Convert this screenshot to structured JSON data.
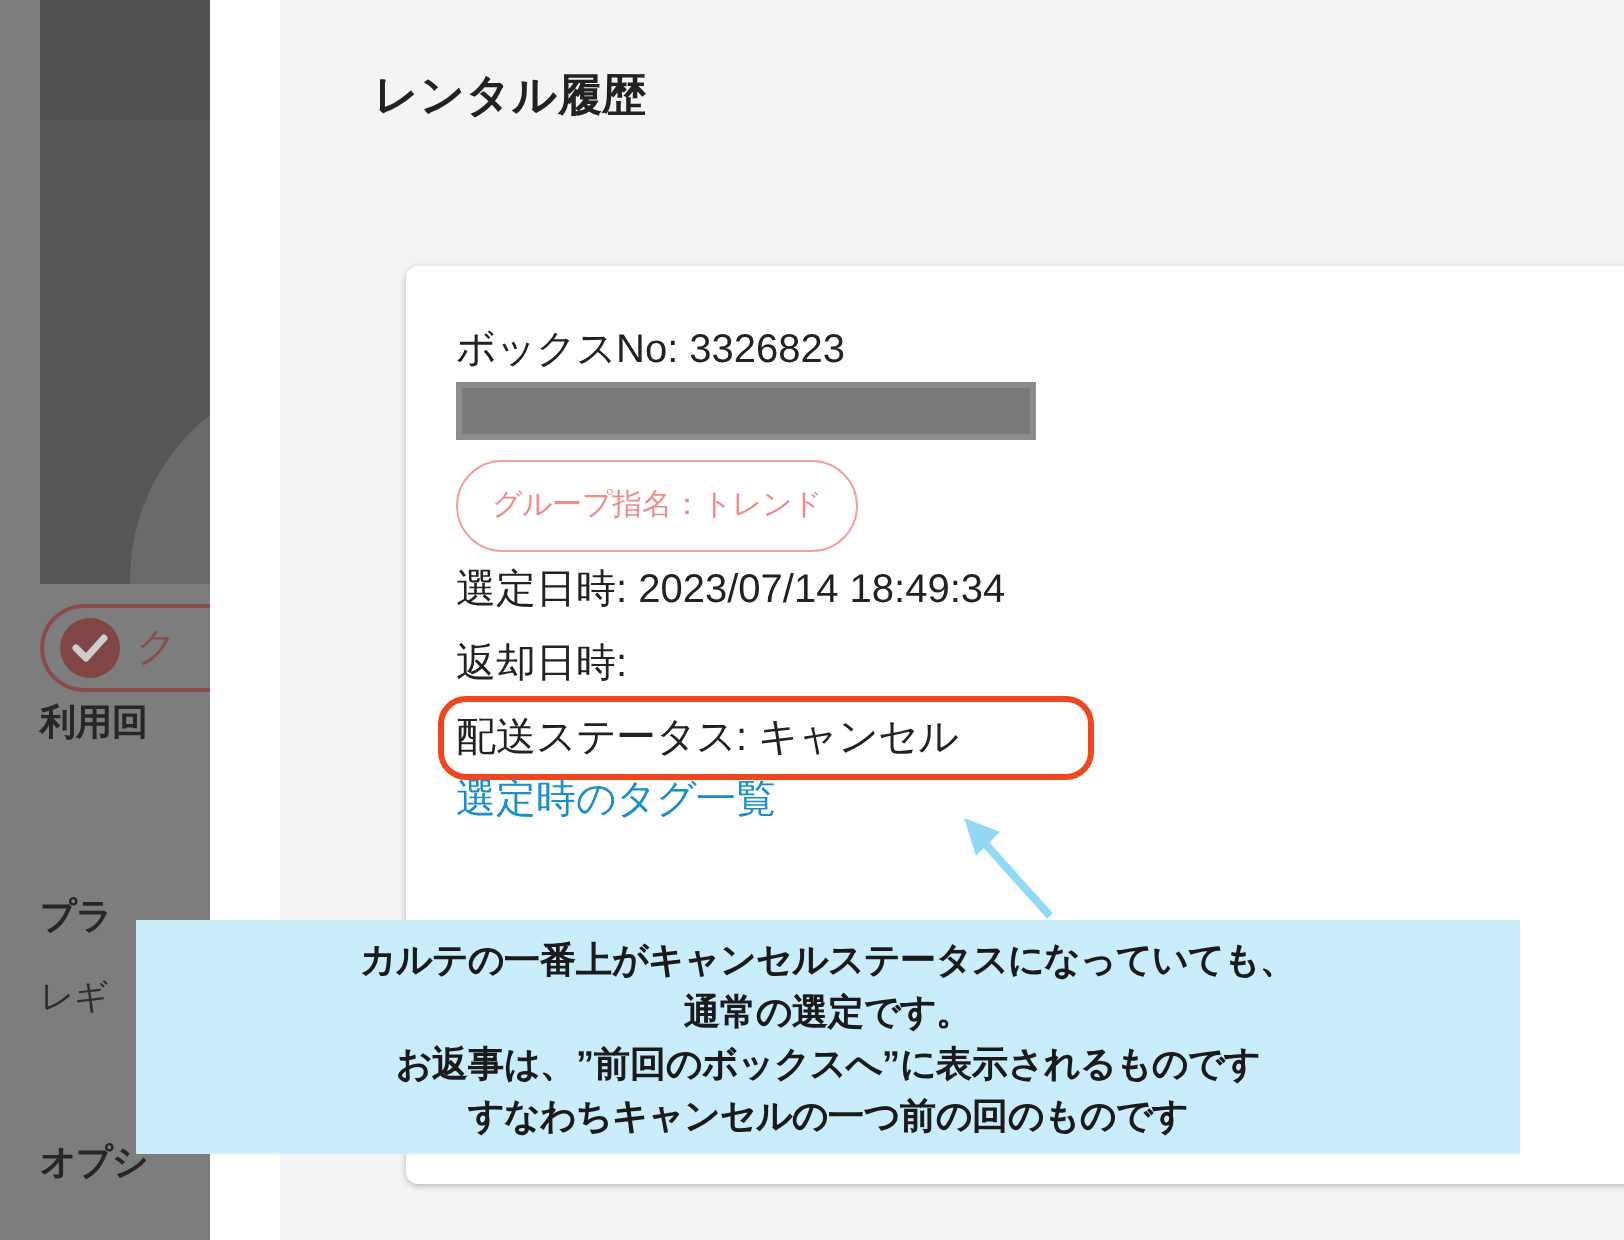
{
  "background_page": {
    "badge": {
      "label": "ク"
    },
    "usage_label": "利用回",
    "plan_label": "プラ",
    "plan_value": "レギ",
    "option_label": "オプシ"
  },
  "dialog": {
    "title": "レンタル履歴",
    "card": {
      "box_no": "ボックスNo: 3326823",
      "tag": "グループ指名：トレンド",
      "selected_at": "選定日時: 2023/07/14 18:49:34",
      "returned_at": "返却日時:",
      "delivery_status": "配送ステータス: キャンセル",
      "tags_link": "選定時のタグ一覧"
    }
  },
  "annotation": {
    "lines": [
      "カルテの一番上がキャンセルステータスになっていても、",
      "通常の選定です。",
      "お返事は、”前回のボックスへ”に表示されるものです",
      "すなわちキャンセルの一つ前の回のものです"
    ]
  }
}
